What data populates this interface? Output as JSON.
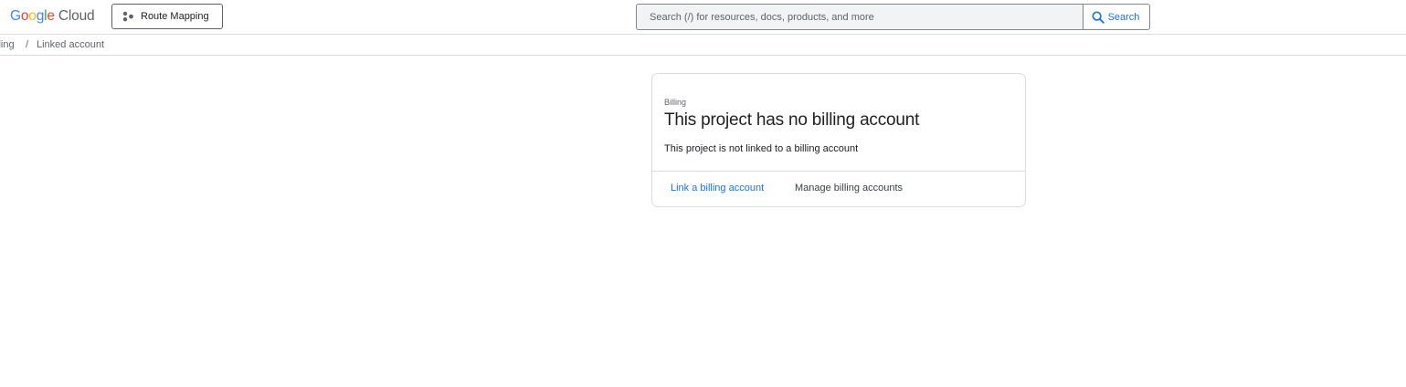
{
  "header": {
    "logo": {
      "letters": [
        {
          "char": "G",
          "color": "#4285F4"
        },
        {
          "char": "o",
          "color": "#EA4335"
        },
        {
          "char": "o",
          "color": "#FBBC05"
        },
        {
          "char": "g",
          "color": "#4285F4"
        },
        {
          "char": "l",
          "color": "#34A853"
        },
        {
          "char": "e",
          "color": "#EA4335"
        }
      ],
      "suffix": "Cloud"
    },
    "project_picker": {
      "label": "Route Mapping",
      "icon": "project-dots-icon"
    },
    "search": {
      "placeholder": "Search (/) for resources, docs, products, and more",
      "value": "",
      "button_label": "Search",
      "icon": "search-icon"
    }
  },
  "breadcrumb": {
    "root": "lling",
    "separator": "/",
    "current": "Linked account"
  },
  "card": {
    "eyebrow": "Billing",
    "title": "This project has no billing account",
    "body": "This project is not linked to a billing account",
    "actions": {
      "link_label": "Link a billing account",
      "manage_label": "Manage billing accounts"
    }
  },
  "colors": {
    "accent": "#1a73e8",
    "border": "#dadce0",
    "text_primary": "#202124",
    "text_secondary": "#5f6368",
    "search_bg": "#f1f3f4"
  }
}
